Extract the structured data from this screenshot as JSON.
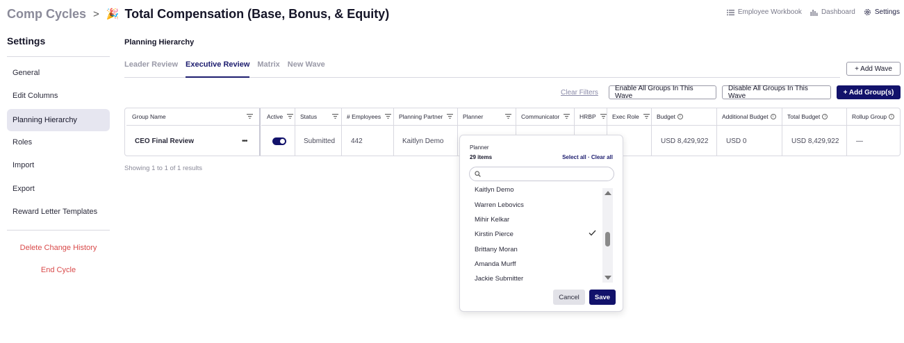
{
  "header": {
    "crumb": "Comp Cycles",
    "separator": ">",
    "emoji": "🎉",
    "title": "Total Compensation (Base, Bonus, & Equity)",
    "nav": [
      {
        "label": "Employee Workbook",
        "icon": "list-icon"
      },
      {
        "label": "Dashboard",
        "icon": "bar-chart-icon"
      },
      {
        "label": "Settings",
        "icon": "gear-icon",
        "active": true
      }
    ]
  },
  "sidebar": {
    "title": "Settings",
    "items": [
      {
        "label": "General"
      },
      {
        "label": "Edit Columns"
      },
      {
        "label": "Planning Hierarchy",
        "active": true
      },
      {
        "label": "Roles"
      },
      {
        "label": "Import"
      },
      {
        "label": "Export"
      },
      {
        "label": "Reward Letter Templates"
      }
    ],
    "danger": [
      {
        "label": "Delete Change History"
      },
      {
        "label": "End Cycle"
      }
    ]
  },
  "main": {
    "section_title": "Planning Hierarchy",
    "tabs": [
      {
        "label": "Leader Review"
      },
      {
        "label": "Executive Review",
        "active": true
      },
      {
        "label": "Matrix"
      },
      {
        "label": "New Wave"
      }
    ],
    "add_wave": "+ Add Wave",
    "clear_filters": "Clear Filters",
    "enable_all": "Enable All Groups In This Wave",
    "disable_all": "Disable All Groups In This Wave",
    "add_groups": "+ Add Group(s)",
    "showing": "Showing 1 to 1 of 1 results"
  },
  "table": {
    "columns": [
      "Group Name",
      "Active",
      "Status",
      "# Employees",
      "Planning Partner",
      "Planner",
      "Communicator",
      "HRBP",
      "Exec Role",
      "Budget",
      "Additional Budget",
      "Total Budget",
      "Rollup Group"
    ],
    "row": {
      "group_name": "CEO Final Review",
      "more": "•••",
      "active": true,
      "status": "Submitted",
      "employees": "442",
      "planning_partner": "Kaitlyn Demo",
      "budget": "USD 8,429,922",
      "additional_budget": "USD 0",
      "total_budget": "USD 8,429,922",
      "rollup_group": "—"
    }
  },
  "dropdown": {
    "title": "Planner",
    "count": "29 items",
    "links": "Select all · Clear all",
    "search_placeholder": "",
    "items": [
      {
        "label": "Kaitlyn Demo",
        "checked": false
      },
      {
        "label": "Warren Lebovics",
        "checked": false
      },
      {
        "label": "Mihir Kelkar",
        "checked": false
      },
      {
        "label": "Kirstin Pierce",
        "checked": true
      },
      {
        "label": "Brittany Moran",
        "checked": false
      },
      {
        "label": "Amanda Murff",
        "checked": false
      },
      {
        "label": "Jackie Submitter",
        "checked": false
      }
    ],
    "cancel": "Cancel",
    "save": "Save"
  },
  "colors": {
    "primary": "#12126b",
    "danger": "#d94a4a",
    "active_bg": "#e6e6f0"
  }
}
